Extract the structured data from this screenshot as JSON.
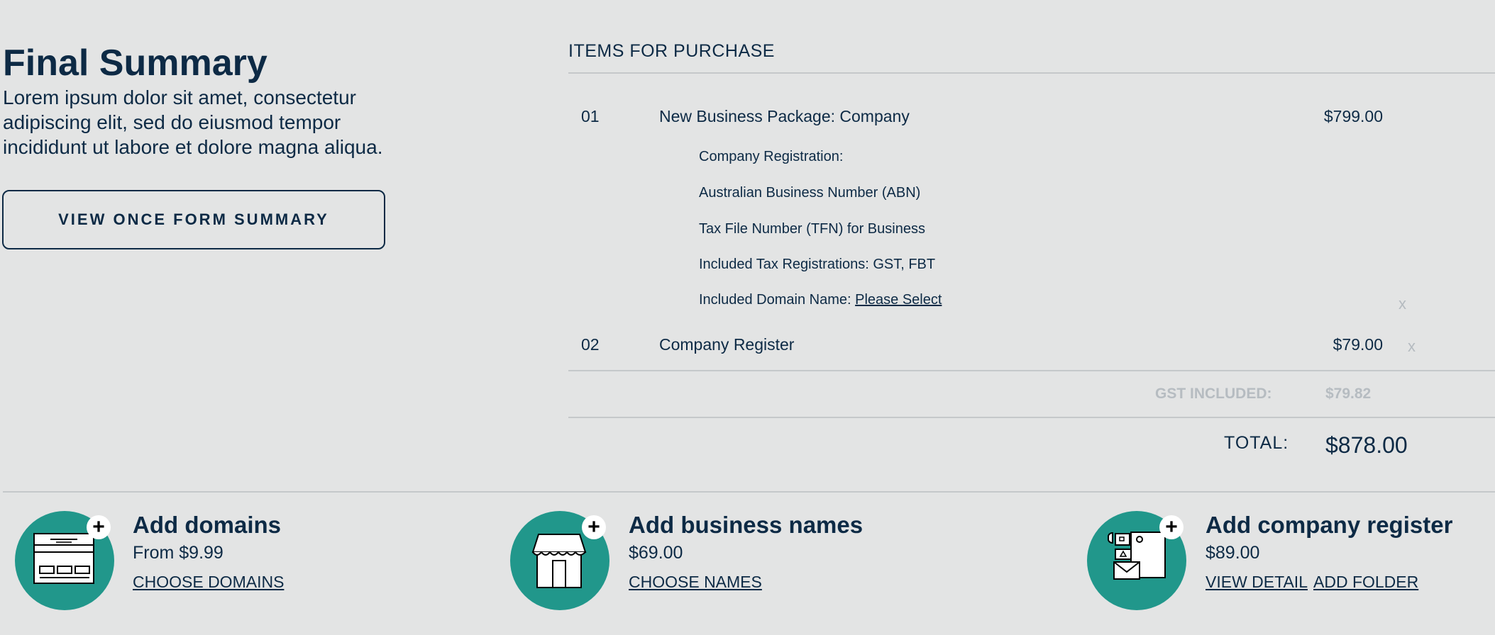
{
  "summary": {
    "title": "Final Summary",
    "intro": "Lorem ipsum dolor sit amet, consectetur adipiscing elit, sed do eiusmod tempor incididunt ut labore et dolore magna aliqua.",
    "button_label": "VIEW ONCE FORM SUMMARY"
  },
  "items": {
    "heading": "ITEMS FOR PURCHASE",
    "list": [
      {
        "number": "01",
        "name": "New Business Package: Company",
        "price": "$799.00",
        "details": [
          "Company Registration:",
          "Australian Business Number (ABN)",
          "Tax File Number (TFN) for Business",
          "Included Tax Registrations: GST, FBT"
        ],
        "domain_label": "Included Domain Name: ",
        "domain_link": "Please Select",
        "remove": "x"
      },
      {
        "number": "02",
        "name": "Company Register",
        "price": "$79.00",
        "remove": "x"
      }
    ],
    "gst_label": "GST INCLUDED:",
    "gst_value": "$79.82",
    "total_label": "TOTAL:",
    "total_value": "$878.00"
  },
  "upsells": [
    {
      "icon": "website-icon",
      "title": "Add domains",
      "price": "From $9.99",
      "links": [
        "CHOOSE DOMAINS"
      ]
    },
    {
      "icon": "storefront-icon",
      "title": "Add business names",
      "price": "$69.00",
      "links": [
        "CHOOSE NAMES"
      ]
    },
    {
      "icon": "documents-icon",
      "title": "Add company register",
      "price": "$89.00",
      "links": [
        "VIEW DETAIL",
        "ADD FOLDER"
      ]
    }
  ],
  "colors": {
    "text": "#0d2a45",
    "background": "#e3e4e4",
    "accent": "#21978b",
    "muted": "#b6bcc1",
    "divider": "#c5c8ca"
  }
}
